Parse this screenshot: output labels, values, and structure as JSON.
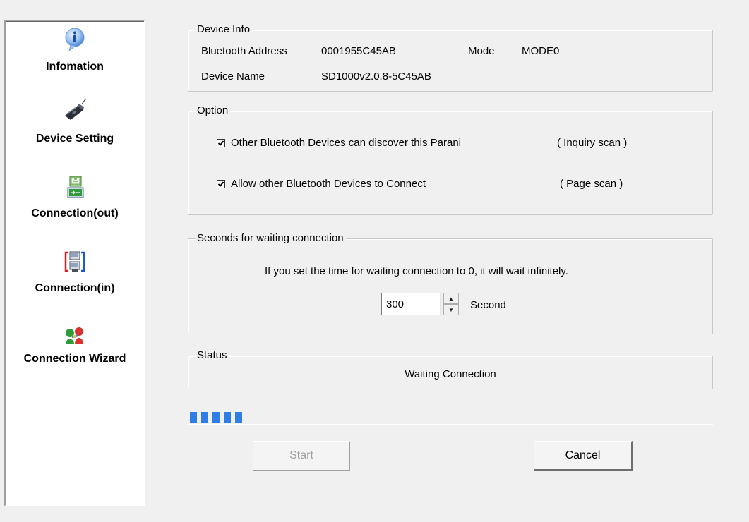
{
  "sidebar": {
    "items": [
      {
        "label": "Infomation",
        "icon": "info-icon"
      },
      {
        "label": "Device Setting",
        "icon": "device-icon"
      },
      {
        "label": "Connection(out)",
        "icon": "connection-out-icon"
      },
      {
        "label": "Connection(in)",
        "icon": "connection-in-icon"
      },
      {
        "label": "Connection Wizard",
        "icon": "wizard-icon"
      }
    ]
  },
  "device_info": {
    "title": "Device Info",
    "address_label": "Bluetooth Address",
    "address_value": "0001955C45AB",
    "mode_label": "Mode",
    "mode_value": "MODE0",
    "name_label": "Device Name",
    "name_value": "SD1000v2.0.8-5C45AB"
  },
  "option": {
    "title": "Option",
    "discover_label": "Other Bluetooth Devices can discover this Parani",
    "discover_note": "( Inquiry scan )",
    "discover_checked": true,
    "connect_label": "Allow other Bluetooth Devices to Connect",
    "connect_note": "( Page scan )",
    "connect_checked": true
  },
  "waiting": {
    "title": "Seconds for waiting connection",
    "hint": "If you set the time for waiting connection to 0, it will wait infinitely.",
    "value": "300",
    "unit": "Second"
  },
  "status": {
    "title": "Status",
    "text": "Waiting Connection"
  },
  "progress": {
    "segments_filled": 5
  },
  "buttons": {
    "start": "Start",
    "cancel": "Cancel"
  },
  "colors": {
    "progress": "#2f7ee6",
    "info_icon": "#3a7bd5"
  }
}
